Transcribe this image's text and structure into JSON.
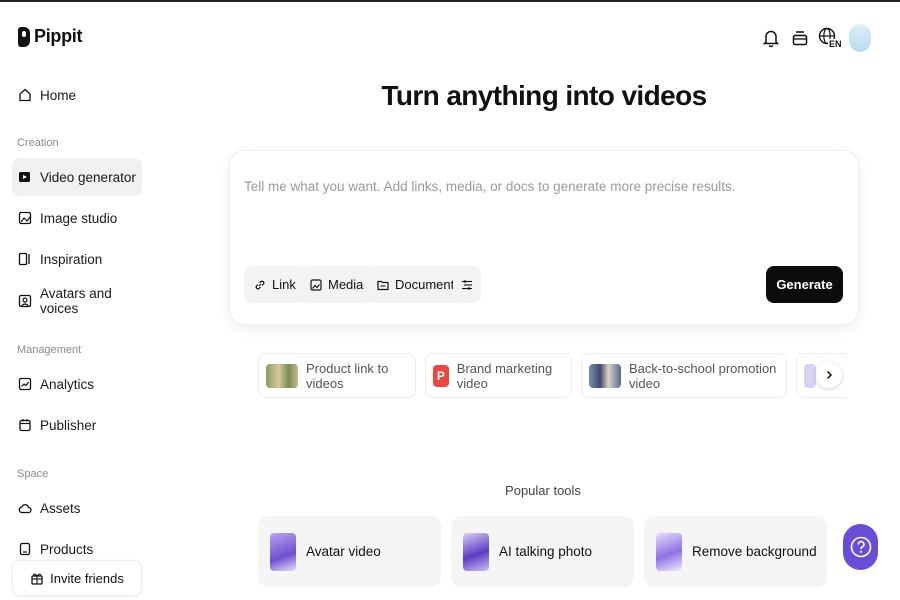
{
  "app": {
    "name": "Pippit"
  },
  "header": {
    "language": "EN"
  },
  "sidebar": {
    "home": "Home",
    "sections": {
      "creation": "Creation",
      "management": "Management",
      "space": "Space"
    },
    "creation_items": [
      "Video generator",
      "Image studio",
      "Inspiration",
      "Avatars and voices"
    ],
    "management_items": [
      "Analytics",
      "Publisher"
    ],
    "space_items": [
      "Assets",
      "Products"
    ],
    "invite": "Invite friends"
  },
  "main": {
    "title": "Turn anything into videos",
    "prompt": {
      "placeholder": "Tell me what you want. Add links, media, or docs to generate more precise results.",
      "chips": [
        "Link",
        "Media",
        "Document"
      ],
      "generate": "Generate"
    },
    "suggestions": [
      "Product link to videos",
      "Brand marketing video",
      "Back-to-school promotion video"
    ],
    "popular_label": "Popular tools",
    "tools": [
      "Avatar video",
      "AI talking photo",
      "Remove background"
    ]
  },
  "colors": {
    "accent": "#6a4dd6",
    "primary_button": "#0c0c0c",
    "active_nav": "#f1f1f3"
  }
}
